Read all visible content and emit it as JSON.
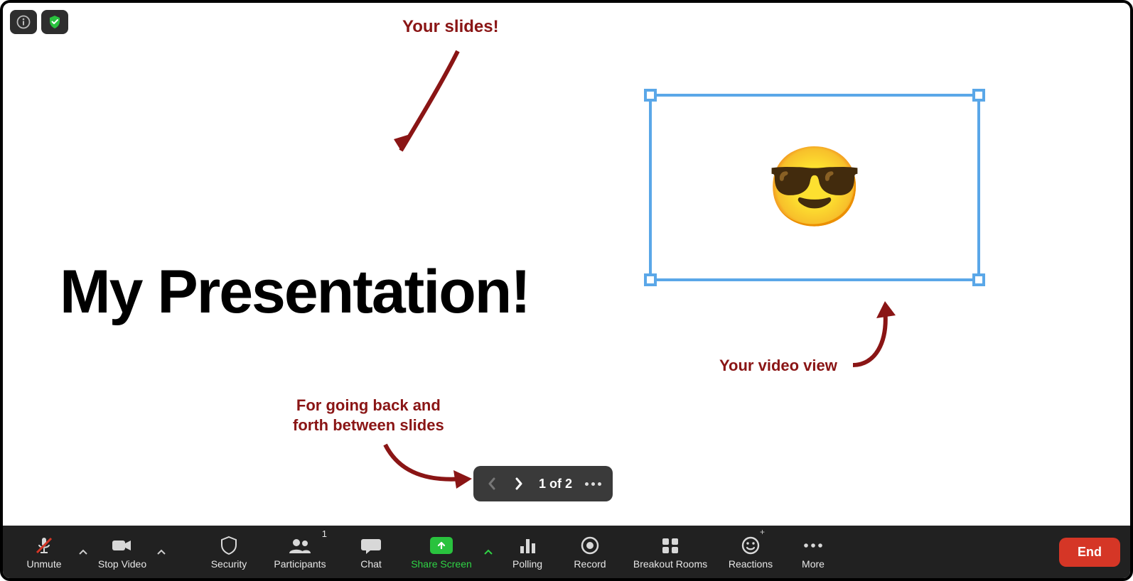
{
  "top_buttons": {
    "info_icon": "info",
    "shield_icon": "shield"
  },
  "slide": {
    "title": "My Presentation!"
  },
  "callouts": {
    "slides": "Your slides!",
    "nav_line1": "For going back and",
    "nav_line2": "forth between slides",
    "video": "Your video view"
  },
  "video_view": {
    "emoji": "😎"
  },
  "slide_nav": {
    "indicator": "1 of 2"
  },
  "toolbar": {
    "unmute": "Unmute",
    "stop_video": "Stop Video",
    "security": "Security",
    "participants": "Participants",
    "participants_count": "1",
    "chat": "Chat",
    "share_screen": "Share Screen",
    "polling": "Polling",
    "record": "Record",
    "breakout_rooms": "Breakout Rooms",
    "reactions": "Reactions",
    "more": "More",
    "end": "End"
  },
  "colors": {
    "accent_green": "#29c23e",
    "annotation": "#8a1515",
    "selection_blue": "#5aa7e8",
    "end_red": "#d53626",
    "toolbar_bg": "#212121"
  }
}
